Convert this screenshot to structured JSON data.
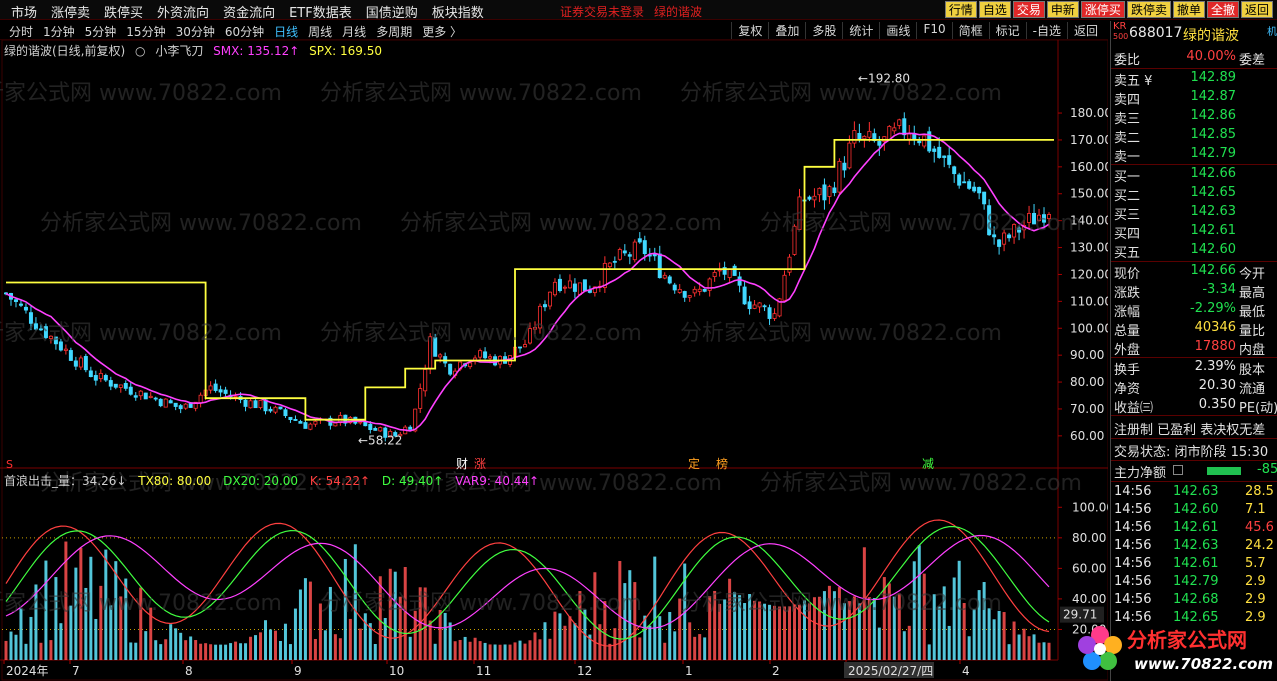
{
  "menu": [
    "市场",
    "涨停卖",
    "跌停买",
    "外资流向",
    "资金流向",
    "ETF数据表",
    "国债逆购",
    "板块指数"
  ],
  "notice": [
    "证券交易未登录",
    "绿的谐波"
  ],
  "top_buttons": [
    {
      "label": "行情",
      "style": "yellow"
    },
    {
      "label": "自选",
      "style": "yellow"
    },
    {
      "label": "交易",
      "style": "red"
    },
    {
      "label": "申新",
      "style": "yellow"
    },
    {
      "label": "涨停买",
      "style": "red"
    },
    {
      "label": "跌停卖",
      "style": "yellow"
    },
    {
      "label": "撤单",
      "style": "yellow"
    },
    {
      "label": "全撤",
      "style": "red"
    },
    {
      "label": "返回",
      "style": "yellow"
    }
  ],
  "periods": [
    "分时",
    "1分钟",
    "5分钟",
    "15分钟",
    "30分钟",
    "60分钟",
    "日线",
    "周线",
    "月线",
    "多周期",
    "更多 〉"
  ],
  "active_period": "日线",
  "chart_tools": [
    "复权",
    "叠加",
    "多股",
    "统计",
    "画线",
    "F10",
    "简框",
    "标记",
    "-自选",
    "返回"
  ],
  "main_title": {
    "stock": "绿的谐波(日线,前复权)",
    "indicator": "小李飞刀",
    "smx": "SMX: 135.12↑",
    "spx": "SPX: 169.50"
  },
  "sub_title": {
    "name": "首浪出击_量：34.26↓",
    "tx80": "TX80: 80.00",
    "dx20": "DX20: 20.00",
    "k": "K: 54.22↑",
    "d": "D: 49.40↑",
    "var9": "VAR9: 40.44↑"
  },
  "annotations": {
    "high": "192.80",
    "low": "58.22",
    "sub_last": "29.71",
    "tags": [
      "财",
      "涨",
      "定",
      "榜",
      "减"
    ],
    "s_mark": "S"
  },
  "x_axis": [
    "2024年",
    "7",
    "8",
    "9",
    "10",
    "11",
    "12",
    "1",
    "2",
    "2025/02/27/四",
    "4"
  ],
  "colors": {
    "up": "#ff3030",
    "down": "#40d8ff",
    "ma": "#ff40ff",
    "step": "#ffff40",
    "k": "#ff4040",
    "d": "#40ff40",
    "var9": "#ff40ff"
  },
  "chart_data": [
    {
      "type": "candlestick",
      "title": "小李飞刀",
      "y_ticks": [
        60,
        70,
        80,
        90,
        100,
        110,
        120,
        130,
        140,
        150,
        160,
        170,
        180
      ],
      "ylim": [
        54,
        196
      ],
      "x_months": [
        "2024年",
        "7",
        "8",
        "9",
        "10",
        "11",
        "12",
        "1",
        "2",
        "2025/02/27/四",
        "4"
      ],
      "series": [
        {
          "name": "SMX",
          "last": 135.12
        },
        {
          "name": "SPX",
          "last": 169.5
        }
      ],
      "max_price": 192.8,
      "min_price": 58.22
    },
    {
      "type": "bar",
      "title": "首浪出击_量",
      "y_ticks": [
        20,
        40,
        60,
        80,
        100
      ],
      "ylim": [
        0,
        110
      ],
      "series": [
        {
          "name": "TX80",
          "value": 80
        },
        {
          "name": "DX20",
          "value": 20
        },
        {
          "name": "K",
          "value": 54.22
        },
        {
          "name": "D",
          "value": 49.4
        },
        {
          "name": "VAR9",
          "value": 40.44
        }
      ]
    }
  ],
  "quote": {
    "badge": "KR",
    "badge_sub": "500",
    "code": "688017",
    "name": "绿的谐波",
    "suffix": "机",
    "weibi_label": "委比",
    "weibi": "40.00%",
    "weicha_label": "委差",
    "asks": [
      {
        "label": "卖五 ¥",
        "price": "142.89"
      },
      {
        "label": "卖四",
        "price": "142.87"
      },
      {
        "label": "卖三",
        "price": "142.86"
      },
      {
        "label": "卖二",
        "price": "142.85"
      },
      {
        "label": "卖一",
        "price": "142.79"
      }
    ],
    "bids": [
      {
        "label": "买一",
        "price": "142.66"
      },
      {
        "label": "买二",
        "price": "142.65"
      },
      {
        "label": "买三",
        "price": "142.63"
      },
      {
        "label": "买四",
        "price": "142.61"
      },
      {
        "label": "买五",
        "price": "142.60"
      }
    ],
    "stats": [
      {
        "label": "现价",
        "value": "142.66",
        "color": "green",
        "r": "今开"
      },
      {
        "label": "涨跌",
        "value": "-3.34",
        "color": "green",
        "r": "最高"
      },
      {
        "label": "涨幅",
        "value": "-2.29%",
        "color": "green",
        "r": "最低"
      },
      {
        "label": "总量",
        "value": "40346",
        "color": "yel",
        "r": "量比"
      },
      {
        "label": "外盘",
        "value": "17880",
        "color": "red",
        "r": "内盘"
      }
    ],
    "stats2": [
      {
        "label": "换手",
        "value": "2.39%",
        "r": "股本"
      },
      {
        "label": "净资",
        "value": "20.30",
        "r": "流通"
      },
      {
        "label": "收益㈢",
        "value": "0.350",
        "r": "PE(动)"
      }
    ],
    "register": "注册制  已盈利  表决权无差",
    "trade_status": "交易状态: 闭市阶段 15:30",
    "net_flow_label": "主力净额",
    "net_flow": "-85",
    "ticks": [
      {
        "time": "14:56",
        "price": "142.63",
        "vol": "28.5",
        "pc": "green",
        "vc": "yel"
      },
      {
        "time": "14:56",
        "price": "142.60",
        "vol": "7.1",
        "pc": "green",
        "vc": "yel"
      },
      {
        "time": "14:56",
        "price": "142.61",
        "vol": "45.6",
        "pc": "green",
        "vc": "red"
      },
      {
        "time": "14:56",
        "price": "142.63",
        "vol": "24.2",
        "pc": "green",
        "vc": "yel"
      },
      {
        "time": "14:56",
        "price": "142.61",
        "vol": "5.7",
        "pc": "green",
        "vc": "yel"
      },
      {
        "time": "14:56",
        "price": "142.79",
        "vol": "2.9",
        "pc": "green",
        "vc": "yel"
      },
      {
        "time": "14:56",
        "price": "142.68",
        "vol": "2.9",
        "pc": "green",
        "vc": "yel"
      },
      {
        "time": "14:56",
        "price": "142.65",
        "vol": "2.9",
        "pc": "green",
        "vc": "yel"
      }
    ]
  },
  "watermark": "分析家公式网 www.70822.com",
  "logo": {
    "name": "分析家公式网",
    "url": "www.70822.com"
  }
}
